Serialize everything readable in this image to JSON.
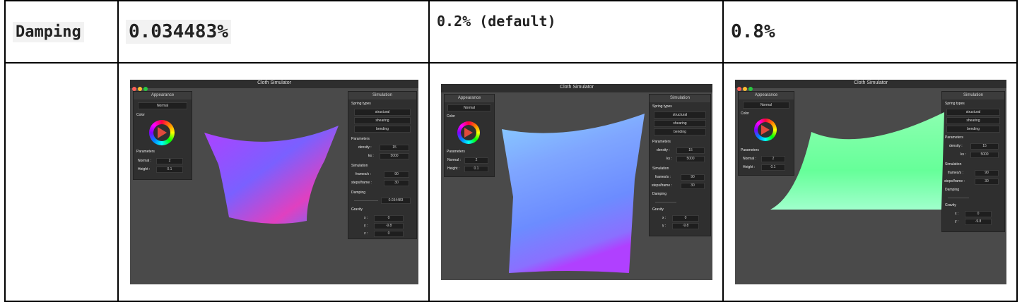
{
  "header": {
    "label": "Damping",
    "col1": "0.034483%",
    "col2": "0.2% (default)",
    "col3": "0.8%"
  },
  "sim": {
    "window_title": "Cloth Simulator",
    "appearance_title": "Appearance",
    "shader": "Normal",
    "color_label": "Color",
    "parameters_label": "Parameters",
    "normal_label": "Normal :",
    "height_label": "Height :",
    "normal_value": "2",
    "height_value": "0.1",
    "simulation_title": "Simulation",
    "spring_types_label": "Spring types",
    "structural": "structural",
    "shearing": "shearing",
    "bending": "bending",
    "sim_parameters": "Parameters",
    "density_label": "density :",
    "ks_label": "ks :",
    "density_value": "15",
    "ks_value": "5000",
    "simulation_label": "Simulation",
    "fps_label": "frames/s :",
    "steps_label": "steps/frame :",
    "fps_value": "90",
    "steps_value": "30",
    "damping_label": "Damping",
    "damping_value": "0.034483",
    "gravity_label": "Gravity",
    "x_label": "x :",
    "y_label": "y :",
    "z_label": "z :",
    "gx": "0",
    "gy": "-9.8",
    "gz": "0",
    "colors": {
      "window_bg": "#4a4a4a",
      "panel_bg": "#2f2f2f",
      "cloth_blue": "#6c8cff",
      "cloth_purple": "#b040ff",
      "cloth_green": "#66ff99"
    }
  }
}
